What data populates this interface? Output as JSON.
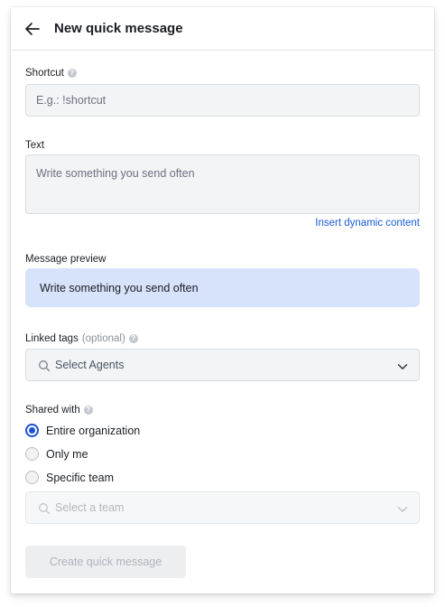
{
  "header": {
    "title": "New quick message"
  },
  "shortcut": {
    "label": "Shortcut",
    "placeholder": "E.g.: !shortcut"
  },
  "text_field": {
    "label": "Text",
    "placeholder": "Write something you send often",
    "link": "Insert dynamic content"
  },
  "preview": {
    "label": "Message preview",
    "text": "Write something you send often"
  },
  "tags": {
    "label": "Linked tags",
    "optional": "(optional)",
    "placeholder": "Select Agents"
  },
  "shared": {
    "label": "Shared with",
    "options": [
      {
        "label": "Entire organization",
        "checked": true
      },
      {
        "label": "Only me",
        "checked": false
      },
      {
        "label": "Specific team",
        "checked": false
      }
    ],
    "team_placeholder": "Select a team"
  },
  "submit_label": "Create quick message",
  "colors": {
    "accent": "#1a4fd6",
    "link": "#1a5bd6",
    "preview_bg": "#d7e2fb"
  }
}
